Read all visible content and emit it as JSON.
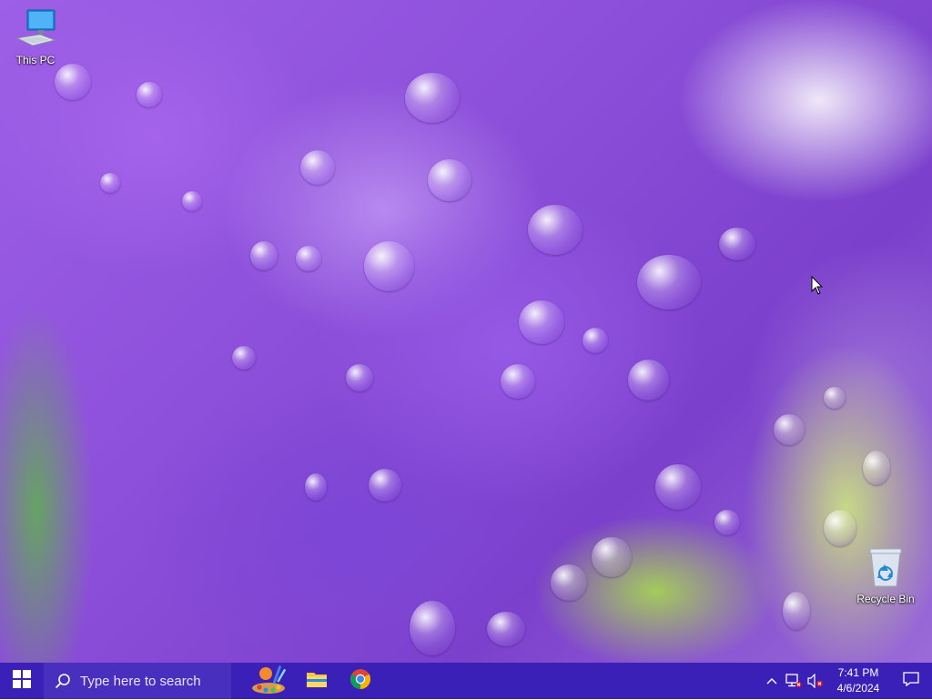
{
  "desktop": {
    "icons": [
      {
        "label": "This PC",
        "icon": "this-pc-icon"
      },
      {
        "label": "Recycle Bin",
        "icon": "recycle-bin-icon"
      }
    ],
    "wallpaper": "purple flower with water droplets",
    "colors": {
      "purple": "#8c4fd9",
      "green": "#a4d84a"
    }
  },
  "taskbar": {
    "color": "#3b20b8",
    "start_icon": "windows-logo-icon",
    "search_placeholder": "Type here to search",
    "pinned_apps": [
      {
        "name": "paint-app",
        "icon": "paint-icon"
      },
      {
        "name": "file-explorer",
        "icon": "folder-icon"
      },
      {
        "name": "chrome",
        "icon": "chrome-icon"
      }
    ],
    "tray": {
      "icons": [
        "chevron-up-icon",
        "network-icon",
        "volume-muted-icon"
      ],
      "time": "7:41 PM",
      "date": "4/6/2024",
      "notification_icon": "notification-icon"
    }
  }
}
